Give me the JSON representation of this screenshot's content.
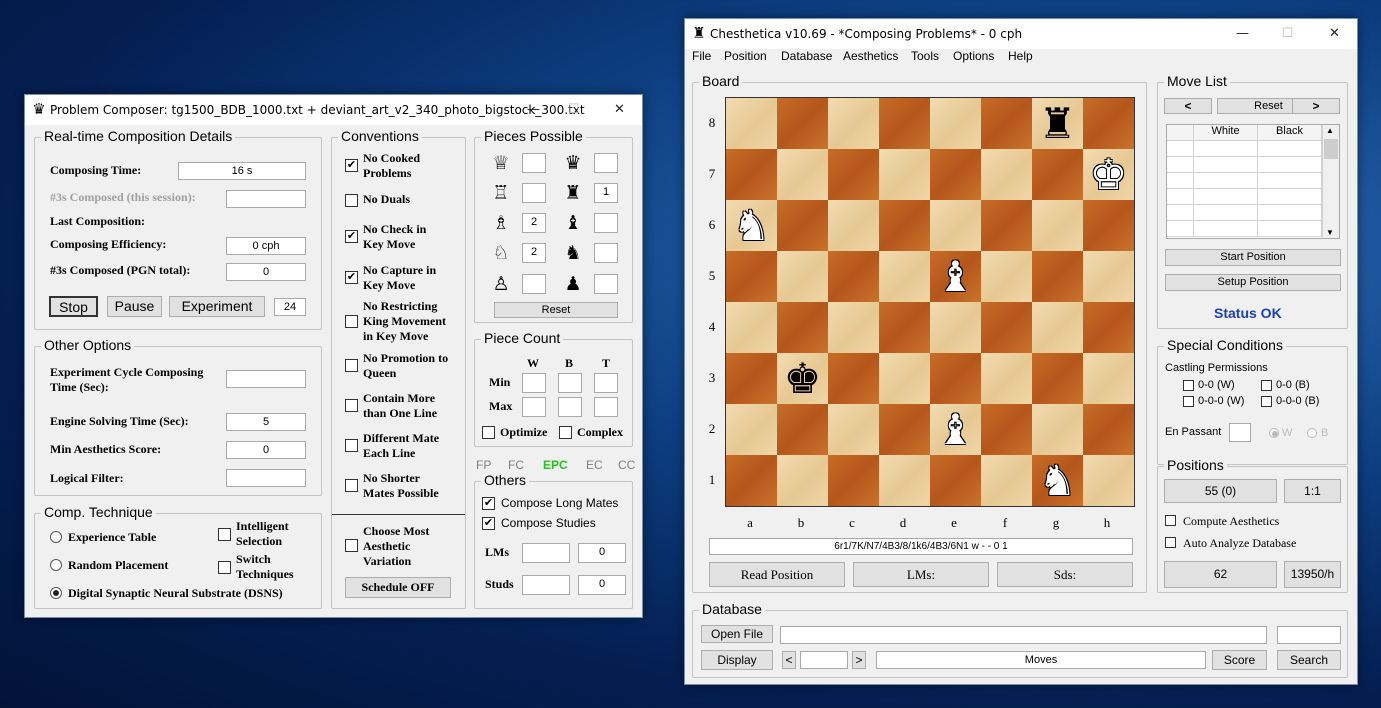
{
  "composer": {
    "title": "Problem Composer: tg1500_BDB_1000.txt + deviant_art_v2_340_photo_bigstock_300.txt",
    "minimize": "—",
    "maximize": "☐",
    "close": "✕",
    "realtime": {
      "title": "Real-time Composition Details",
      "composing_time_label": "Composing Time:",
      "composing_time": "16 s",
      "composed_session_label": "#3s Composed (this session):",
      "composed_session": "",
      "last_composition_label": "Last Composition:",
      "efficiency_label": "Composing Efficiency:",
      "efficiency": "0 cph",
      "composed_pgn_label": "#3s Composed (PGN total):",
      "composed_pgn": "0",
      "stop": "Stop",
      "pause": "Pause",
      "experiment": "Experiment",
      "experiment_count": "24"
    },
    "other_options": {
      "title": "Other Options",
      "cycle_label_1": "Experiment Cycle Composing",
      "cycle_label_2": "Time (Sec):",
      "cycle_value": "",
      "engine_label": "Engine Solving Time (Sec):",
      "engine_value": "5",
      "min_aesthetics_label": "Min Aesthetics Score:",
      "min_aesthetics_value": "0",
      "logical_filter_label": "Logical Filter:",
      "logical_filter_value": ""
    },
    "technique": {
      "title": "Comp. Technique",
      "experience_table": "Experience Table",
      "random_placement": "Random Placement",
      "dsns": "Digital Synaptic Neural Substrate (DSNS)",
      "intelligent_1": "Intelligent",
      "intelligent_2": "Selection",
      "switch_1": "Switch",
      "switch_2": "Techniques"
    },
    "conventions": {
      "title": "Conventions",
      "items": [
        {
          "l1": "No Cooked",
          "l2": "Problems",
          "checked": "✔"
        },
        {
          "l1": "No Duals",
          "l2": "",
          "checked": ""
        },
        {
          "l1": "No Check in",
          "l2": "Key Move",
          "checked": "✔"
        },
        {
          "l1": "No Capture in",
          "l2": "Key Move",
          "checked": "✔"
        },
        {
          "l1": "No Restricting",
          "l2": "King Movement",
          "l3": "in Key Move",
          "checked": ""
        },
        {
          "l1": "No Promotion to",
          "l2": "Queen",
          "checked": ""
        },
        {
          "l1": "Contain More",
          "l2": "than One Line",
          "checked": ""
        },
        {
          "l1": "Different Mate",
          "l2": "Each Line",
          "checked": ""
        },
        {
          "l1": "No Shorter",
          "l2": "Mates Possible",
          "checked": ""
        }
      ],
      "aesthetic_1": "Choose Most",
      "aesthetic_2": "Aesthetic",
      "aesthetic_3": "Variation",
      "schedule": "Schedule OFF"
    },
    "pieces_possible": {
      "title": "Pieces Possible",
      "rows": [
        {
          "w_icon": "♕",
          "w_val": "",
          "b_icon": "♛",
          "b_val": ""
        },
        {
          "w_icon": "♖",
          "w_val": "",
          "b_icon": "♜",
          "b_val": "1"
        },
        {
          "w_icon": "♗",
          "w_val": "2",
          "b_icon": "♝",
          "b_val": ""
        },
        {
          "w_icon": "♘",
          "w_val": "2",
          "b_icon": "♞",
          "b_val": ""
        },
        {
          "w_icon": "♙",
          "w_val": "",
          "b_icon": "♟",
          "b_val": ""
        }
      ],
      "reset": "Reset"
    },
    "piece_count": {
      "title": "Piece Count",
      "w": "W",
      "b": "B",
      "t": "T",
      "min": "Min",
      "max": "Max",
      "optimize": "Optimize",
      "complex": "Complex"
    },
    "modes": {
      "fp": "FP",
      "fc": "FC",
      "epc": "EPC",
      "ec": "EC",
      "cc": "CC",
      "active_color": "#22c422"
    },
    "others": {
      "title": "Others",
      "long_mates": "Compose Long Mates",
      "studies": "Compose Studies",
      "lms": "LMs",
      "lms_value": "0",
      "studs": "Studs",
      "studs_value": "0"
    }
  },
  "main": {
    "title": "Chesthetica v10.69 - *Composing Problems* - 0 cph",
    "minimize": "—",
    "maximize": "☐",
    "close": "✕",
    "menu": [
      "File",
      "Position",
      "Database",
      "Aesthetics",
      "Tools",
      "Options",
      "Help"
    ],
    "board_title": "Board",
    "ranks": [
      "8",
      "7",
      "6",
      "5",
      "4",
      "3",
      "2",
      "1"
    ],
    "files": [
      "a",
      "b",
      "c",
      "d",
      "e",
      "f",
      "g",
      "h"
    ],
    "pieces": [
      {
        "sq": "g8",
        "glyph": "♜",
        "side": "black",
        "name": "black-rook"
      },
      {
        "sq": "h7",
        "glyph": "♚",
        "side": "white",
        "name": "white-king"
      },
      {
        "sq": "a6",
        "glyph": "♞",
        "side": "white",
        "name": "white-knight"
      },
      {
        "sq": "e5",
        "glyph": "♝",
        "side": "white",
        "name": "white-bishop"
      },
      {
        "sq": "b3",
        "glyph": "♚",
        "side": "black",
        "name": "black-king"
      },
      {
        "sq": "e2",
        "glyph": "♝",
        "side": "white",
        "name": "white-bishop"
      },
      {
        "sq": "g1",
        "glyph": "♞",
        "side": "white",
        "name": "white-knight"
      }
    ],
    "fen": "6r1/7K/N7/4B3/8/1k6/4B3/6N1 w - - 0 1",
    "read_position": "Read Position",
    "lms": "LMs:",
    "sds": "Sds:",
    "move_list": {
      "title": "Move List",
      "prev": "<",
      "reset": "Reset",
      "next": ">",
      "white": "White",
      "black": "Black",
      "start_position": "Start Position",
      "setup_position": "Setup Position",
      "status": "Status OK",
      "status_color": "#1a3fbf"
    },
    "special": {
      "title": "Special Conditions",
      "castling": "Castling Permissions",
      "w00": "0-0 (W)",
      "b00": "0-0 (B)",
      "w000": "0-0-0 (W)",
      "b000": "0-0-0 (B)",
      "en_passant": "En Passant",
      "w": "W",
      "b": "B"
    },
    "positions": {
      "title": "Positions",
      "count": "55 (0)",
      "ratio": "1:1",
      "compute": "Compute Aesthetics",
      "auto": "Auto Analyze Database",
      "num": "62",
      "rate": "13950/h"
    },
    "database": {
      "title": "Database",
      "open_file": "Open File",
      "display": "Display",
      "prev": "<",
      "next": ">",
      "moves": "Moves",
      "score": "Score",
      "search": "Search"
    }
  }
}
